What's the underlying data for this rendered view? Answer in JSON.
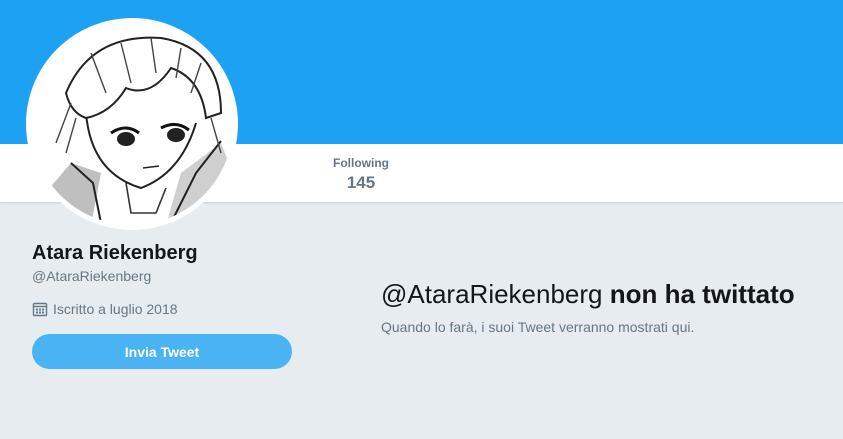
{
  "colors": {
    "banner": "#1da1f2",
    "background": "#e6ecf0",
    "button": "#4ab3f4",
    "muted_text": "#657786",
    "primary_text": "#14171a"
  },
  "nav": {
    "following_label": "Following",
    "following_count": "145"
  },
  "profile": {
    "name": "Atara Riekenberg",
    "handle": "@AtaraRiekenberg",
    "joined_icon": "calendar-icon",
    "joined": "Iscritto a luglio 2018",
    "tweet_button": "Invia Tweet"
  },
  "timeline": {
    "empty_handle": "@AtaraRiekenberg",
    "empty_title": "non ha twittato",
    "empty_message": "Quando lo farà, i suoi Tweet verranno mostrati qui."
  }
}
